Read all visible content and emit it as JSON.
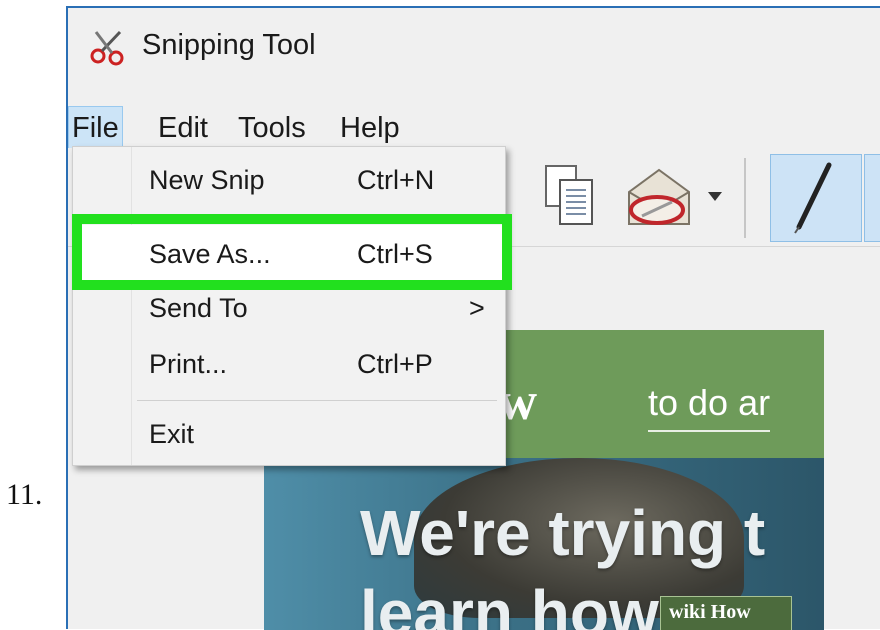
{
  "step": {
    "number": "11."
  },
  "window": {
    "title": "Snipping Tool"
  },
  "menu_bar": {
    "file": "File",
    "edit": "Edit",
    "tools": "Tools",
    "help": "Help"
  },
  "file_menu": {
    "items": [
      {
        "label": "New Snip",
        "shortcut": "Ctrl+N"
      },
      {
        "label": "Save As...",
        "shortcut": "Ctrl+S"
      },
      {
        "label": "Send To",
        "submenu_indicator": ">"
      },
      {
        "label": "Print...",
        "shortcut": "Ctrl+P"
      },
      {
        "label": "Exit"
      }
    ]
  },
  "captured_page": {
    "logo": "iHow",
    "tagline": "to do ar",
    "headline_1": "We're trying t",
    "headline_2": "learn how",
    "badge": "wiki How"
  },
  "colors": {
    "highlight": "#22e01e",
    "window_border": "#2a6fb5",
    "menu_selected": "#cce4f7",
    "capture_header": "#6e9b5a"
  },
  "icons": [
    "scissors-icon",
    "copy-icon",
    "send-snip-icon",
    "dropdown-arrow-icon",
    "pen-icon"
  ]
}
